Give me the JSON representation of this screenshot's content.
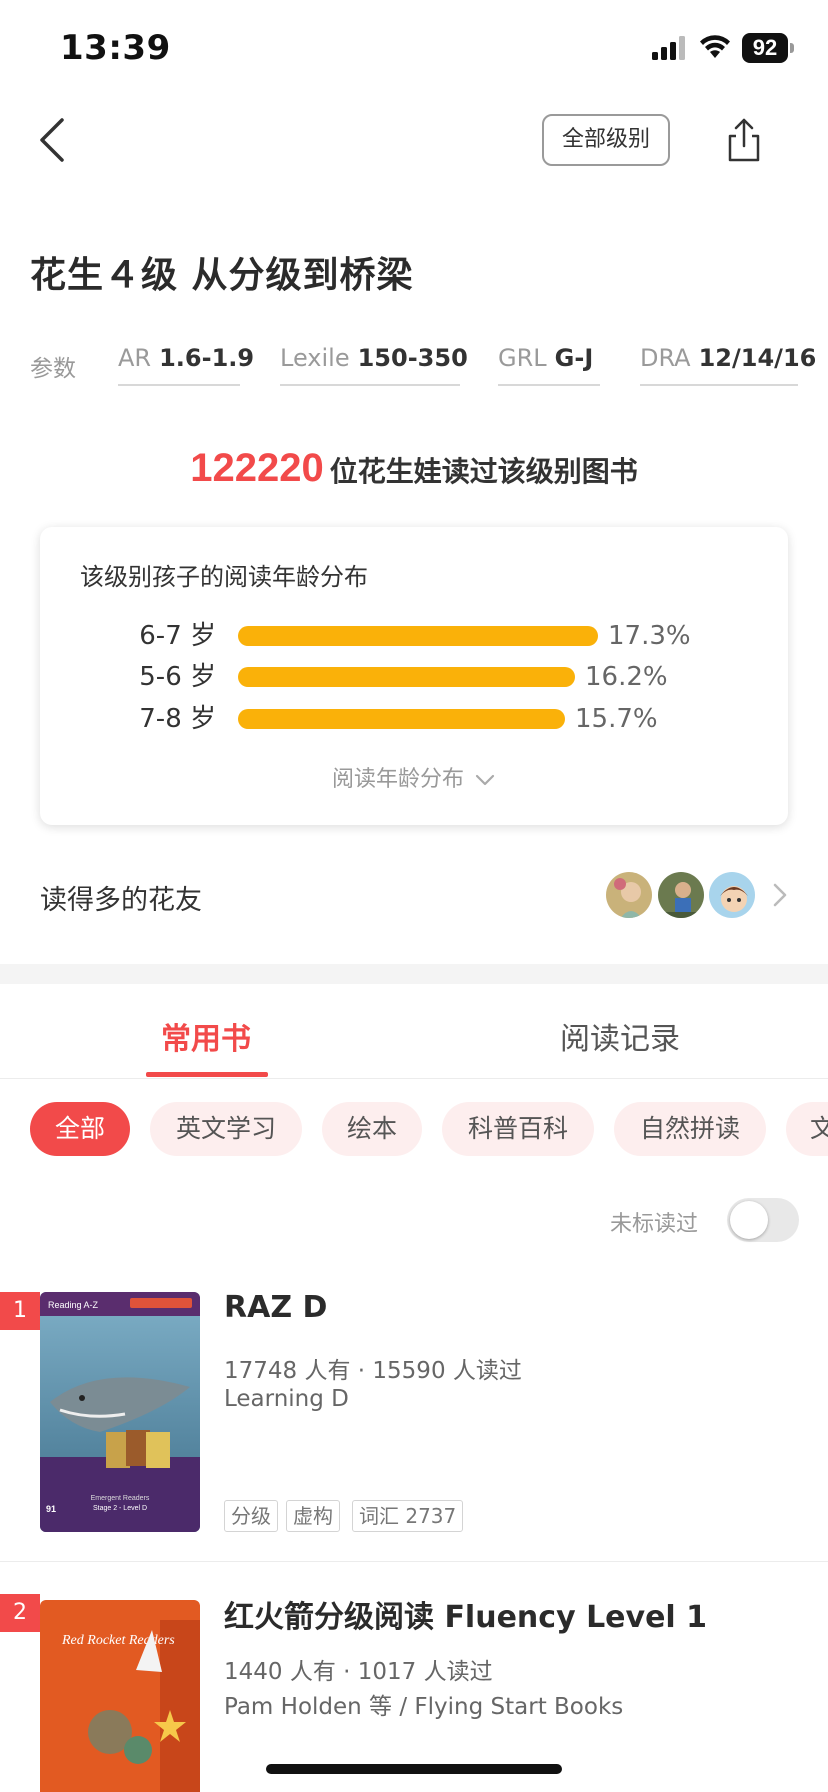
{
  "status_bar": {
    "time": "13:39",
    "battery": "92"
  },
  "header": {
    "level_button": "全部级别",
    "title": "花生４级 从分级到桥梁"
  },
  "params": {
    "label": "参数",
    "items": [
      {
        "key": "AR",
        "value": "1.6-1.9"
      },
      {
        "key": "Lexile",
        "value": "150-350"
      },
      {
        "key": "GRL",
        "value": "G-J"
      },
      {
        "key": "DRA",
        "value": "12/14/16"
      }
    ]
  },
  "readers": {
    "count": "122220",
    "text": "位花生娃读过该级别图书"
  },
  "age_distribution": {
    "title": "该级别孩子的阅读年龄分布",
    "rows": [
      {
        "label": "6-7 岁",
        "percent": 17.3,
        "percent_text": "17.3%"
      },
      {
        "label": "5-6 岁",
        "percent": 16.2,
        "percent_text": "16.2%"
      },
      {
        "label": "7-8 岁",
        "percent": 15.7,
        "percent_text": "15.7%"
      }
    ],
    "toggle": "阅读年龄分布"
  },
  "friends": {
    "label": "读得多的花友"
  },
  "tabs": [
    {
      "label": "常用书",
      "active": true
    },
    {
      "label": "阅读记录",
      "active": false
    }
  ],
  "chips": [
    {
      "label": "全部",
      "active": true
    },
    {
      "label": "英文学习",
      "active": false
    },
    {
      "label": "绘本",
      "active": false
    },
    {
      "label": "科普百科",
      "active": false
    },
    {
      "label": "自然拼读",
      "active": false
    },
    {
      "label": "文",
      "active": false
    }
  ],
  "filter": {
    "unmarked_label": "未标读过",
    "unmarked_on": false
  },
  "books": [
    {
      "rank": "1",
      "title": "RAZ D",
      "stats": "17748 人有 · 15590 人读过",
      "author": "Learning D",
      "tags": [
        "分级",
        "虚构",
        "词汇 2737"
      ],
      "cover": {
        "brand": "Reading A-Z",
        "subtitle": "Emergent Readers",
        "series": "Stage 2 - Level D",
        "corner": "91"
      }
    },
    {
      "rank": "2",
      "title": "红火箭分级阅读  Fluency Level 1",
      "stats": "1440 人有 · 1017 人读过",
      "author": "Pam Holden 等 / Flying Start Books",
      "tags": [],
      "cover": {
        "brand": "Red Rocket Readers"
      }
    }
  ],
  "colors": {
    "accent": "#f24a4a",
    "bar": "#fab109",
    "chip_bg": "#fdeeee"
  }
}
